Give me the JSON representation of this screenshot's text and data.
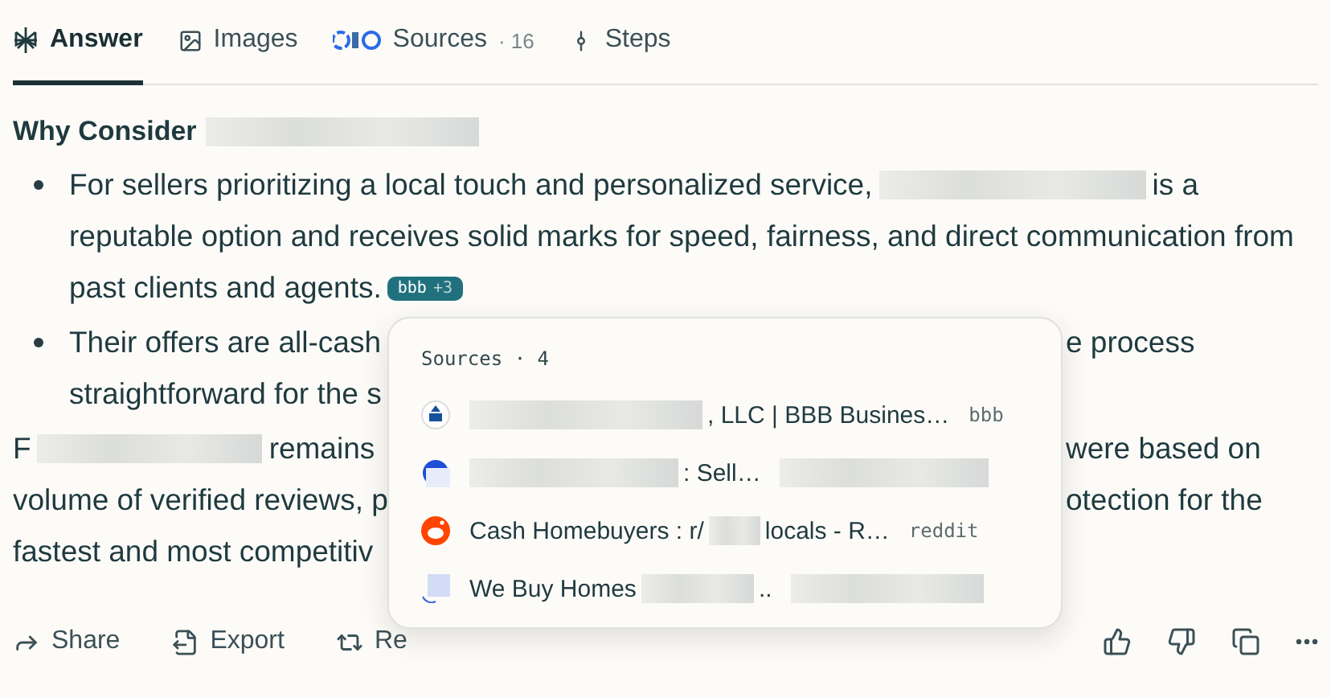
{
  "tabs": [
    {
      "kind": "answer",
      "label": "Answer",
      "selected": true
    },
    {
      "kind": "images",
      "label": "Images",
      "selected": false
    },
    {
      "kind": "sources",
      "label": "Sources",
      "count": "· 16",
      "selected": false
    },
    {
      "kind": "steps",
      "label": "Steps",
      "selected": false
    }
  ],
  "heading": [
    {
      "kind": "text",
      "text": "Why Consider"
    },
    {
      "kind": "redacted"
    }
  ],
  "blocks": [
    {
      "kind": "bullet",
      "lines": [
        [
          {
            "kind": "text",
            "text": "For sellers prioritizing a local touch and personalized service,"
          },
          {
            "kind": "redacted"
          },
          {
            "kind": "text",
            "text": "is a"
          }
        ],
        [
          {
            "kind": "text",
            "text": "reputable option and receives solid marks for speed, fairness, and direct communication from"
          }
        ],
        [
          {
            "kind": "text",
            "text": "past clients and agents."
          },
          {
            "kind": "citation",
            "text": "bbb",
            "extra": "+3"
          }
        ]
      ]
    },
    {
      "kind": "bullet",
      "lines": [
        [
          {
            "kind": "text",
            "text": "Their offers are all-cash"
          },
          {
            "kind": "covered"
          },
          {
            "kind": "text",
            "text": "e process"
          }
        ],
        [
          {
            "kind": "text",
            "text": "straightforward for the s"
          }
        ]
      ]
    },
    {
      "kind": "paragraph",
      "lines": [
        [
          {
            "kind": "text",
            "text": "F"
          },
          {
            "kind": "redacted"
          },
          {
            "kind": "text",
            "text": "remains"
          },
          {
            "kind": "covered"
          },
          {
            "kind": "text",
            "text": "were based on"
          }
        ],
        [
          {
            "kind": "text",
            "text": "volume of verified reviews, p"
          },
          {
            "kind": "covered"
          },
          {
            "kind": "text",
            "text": "otection for the"
          }
        ],
        [
          {
            "kind": "text",
            "text": "fastest and most competitiv"
          }
        ]
      ]
    }
  ],
  "popup": {
    "title": "Sources",
    "count": "· 4",
    "items": [
      {
        "kind": "bbb",
        "title": [
          {
            "kind": "redacted"
          },
          {
            "kind": "text",
            "text": ", LLC | BBB Busines…"
          }
        ],
        "domain": [
          {
            "kind": "text",
            "text": "bbb"
          }
        ]
      },
      {
        "kind": "blue",
        "title": [
          {
            "kind": "redacted"
          },
          {
            "kind": "text",
            "text": ": Sell…"
          }
        ],
        "domain": [
          {
            "kind": "redacted"
          }
        ]
      },
      {
        "kind": "reddit",
        "title": [
          {
            "kind": "text",
            "text": "Cash Homebuyers : r/"
          },
          {
            "kind": "redacted"
          },
          {
            "kind": "text",
            "text": "locals - R…"
          }
        ],
        "domain": [
          {
            "kind": "text",
            "text": "reddit"
          }
        ]
      },
      {
        "kind": "square",
        "title": [
          {
            "kind": "text",
            "text": "We Buy Homes"
          },
          {
            "kind": "redacted"
          },
          {
            "kind": "text",
            "text": ".."
          }
        ],
        "domain": [
          {
            "kind": "redacted"
          }
        ]
      }
    ]
  },
  "actions": [
    {
      "kind": "share",
      "label": "Share"
    },
    {
      "kind": "export",
      "label": "Export"
    },
    {
      "kind": "rewrite",
      "label": "Re"
    }
  ],
  "tools": [
    {
      "kind": "like"
    },
    {
      "kind": "dislike"
    },
    {
      "kind": "copy"
    },
    {
      "kind": "more"
    }
  ]
}
